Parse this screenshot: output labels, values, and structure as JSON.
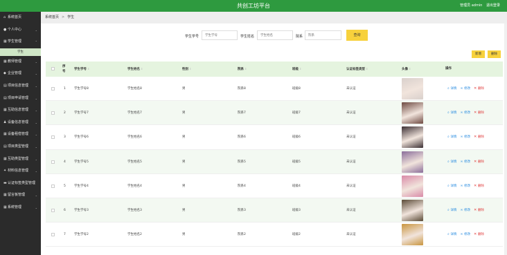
{
  "header": {
    "title": "共创工坊平台",
    "user_label": "管理员 admin",
    "logout_label": "退出登录"
  },
  "sidebar": {
    "items": [
      {
        "label": "系统首页",
        "icon": "home-icon",
        "expandable": false
      },
      {
        "label": "个人中心",
        "icon": "user-icon",
        "expandable": true
      },
      {
        "label": "学生管理",
        "icon": "grid-icon",
        "expandable": true,
        "expanded": true
      },
      {
        "label": "学生",
        "sub": true
      },
      {
        "label": "教师管理",
        "icon": "grid-icon",
        "expandable": true
      },
      {
        "label": "企业管理",
        "icon": "shield-icon",
        "expandable": true
      },
      {
        "label": "项目信息管理",
        "icon": "document-icon",
        "expandable": true
      },
      {
        "label": "项目申请管理",
        "icon": "document-icon",
        "expandable": true
      },
      {
        "label": "互助信息管理",
        "icon": "grid-icon",
        "expandable": true
      },
      {
        "label": "设备信息管理",
        "icon": "person-icon",
        "expandable": true
      },
      {
        "label": "设备租借管理",
        "icon": "grid-icon",
        "expandable": true
      },
      {
        "label": "项目类型管理",
        "icon": "document-icon",
        "expandable": true
      },
      {
        "label": "互助类型管理",
        "icon": "grid-icon",
        "expandable": true
      },
      {
        "label": "材料信息管理",
        "icon": "bulb-icon",
        "expandable": true
      },
      {
        "label": "认证标签类型管理",
        "icon": "card-icon",
        "expandable": false
      },
      {
        "label": "留言板管理",
        "icon": "grid-icon",
        "expandable": true
      },
      {
        "label": "系统管理",
        "icon": "grid-icon",
        "expandable": true
      }
    ]
  },
  "breadcrumb": {
    "home": "系统首页",
    "separator": ">",
    "current": "学生"
  },
  "search": {
    "fields": [
      {
        "label": "学生学号",
        "placeholder": "学生学号"
      },
      {
        "label": "学生姓名",
        "placeholder": "学生姓名"
      },
      {
        "label": "院系",
        "placeholder": "院系"
      }
    ],
    "query_label": "查询"
  },
  "actions": {
    "add_label": "新增",
    "delete_label": "删除"
  },
  "table": {
    "headers": [
      "序号",
      "学生学号",
      "学生姓名",
      "性别",
      "院系",
      "班级",
      "认证标签类型",
      "头像",
      "操作"
    ],
    "rows": [
      {
        "idx": "1",
        "no": "学生学号8",
        "name": "学生姓名8",
        "gender": "男",
        "dept": "院系8",
        "cls": "班级8",
        "cert": "未认证",
        "avatar_color": "#d9d0cc"
      },
      {
        "idx": "2",
        "no": "学生学号7",
        "name": "学生姓名7",
        "gender": "男",
        "dept": "院系7",
        "cls": "班级7",
        "cert": "未认证",
        "avatar_color": "#6e4a42"
      },
      {
        "idx": "3",
        "no": "学生学号6",
        "name": "学生姓名6",
        "gender": "男",
        "dept": "院系6",
        "cls": "班级6",
        "cert": "未认证",
        "avatar_color": "#3b2f33"
      },
      {
        "idx": "4",
        "no": "学生学号5",
        "name": "学生姓名5",
        "gender": "男",
        "dept": "院系5",
        "cls": "班级5",
        "cert": "未认证",
        "avatar_color": "#8a6d9a"
      },
      {
        "idx": "5",
        "no": "学生学号4",
        "name": "学生姓名4",
        "gender": "男",
        "dept": "院系4",
        "cls": "班级4",
        "cert": "未认证",
        "avatar_color": "#d98aa8"
      },
      {
        "idx": "6",
        "no": "学生学号3",
        "name": "学生姓名3",
        "gender": "男",
        "dept": "院系3",
        "cls": "班级3",
        "cert": "未认证",
        "avatar_color": "#5a4a36"
      },
      {
        "idx": "7",
        "no": "学生学号2",
        "name": "学生姓名2",
        "gender": "男",
        "dept": "院系2",
        "cls": "班级2",
        "cert": "未认证",
        "avatar_color": "#c9953f"
      }
    ],
    "op_detail": "详情",
    "op_edit": "修改",
    "op_delete": "删除"
  },
  "colors": {
    "header_green": "#2e9a3f",
    "sidebar_dark": "#2b2b2b",
    "button_yellow": "#f7d13c",
    "table_header_bg": "#e5f4df",
    "link_blue": "#2b8de0",
    "delete_red": "#e03b3b"
  }
}
